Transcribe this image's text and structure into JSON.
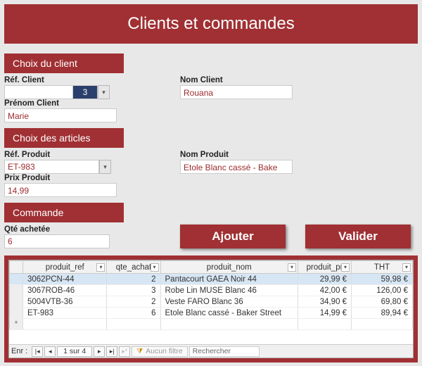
{
  "title": "Clients et commandes",
  "sections": {
    "client": "Choix du client",
    "articles": "Choix des articles",
    "commande": "Commande"
  },
  "labels": {
    "ref_client": "Réf. Client",
    "nom_client": "Nom Client",
    "prenom_client": "Prénom Client",
    "ref_produit": "Réf. Produit",
    "nom_produit": "Nom Produit",
    "prix_produit": "Prix Produit",
    "qte": "Qté achetée"
  },
  "values": {
    "ref_client": "3",
    "nom_client": "Rouana",
    "prenom_client": "Marie",
    "ref_produit": "ET-983",
    "nom_produit": "Etole Blanc cassé - Bake",
    "prix_produit": "14,99",
    "qte": "6"
  },
  "buttons": {
    "ajouter": "Ajouter",
    "valider": "Valider"
  },
  "grid": {
    "headers": {
      "produit_ref": "produit_ref",
      "qte_achat": "qte_achat",
      "produit_nom": "produit_nom",
      "produit_pr": "produit_pr",
      "tht": "THT"
    },
    "rows": [
      {
        "ref": "3062PCN-44",
        "qte": "2",
        "nom": "Pantacourt GAEA Noir 44",
        "prix": "29,99 €",
        "tht": "59,98 €"
      },
      {
        "ref": "3067ROB-46",
        "qte": "3",
        "nom": "Robe Lin MUSE Blanc 46",
        "prix": "42,00 €",
        "tht": "126,00 €"
      },
      {
        "ref": "5004VTB-36",
        "qte": "2",
        "nom": "Veste FARO Blanc 36",
        "prix": "34,90 €",
        "tht": "69,80 €"
      },
      {
        "ref": "ET-983",
        "qte": "6",
        "nom": "Etole Blanc cassé - Baker Street",
        "prix": "14,99 €",
        "tht": "89,94 €"
      }
    ],
    "nav": {
      "label": "Enr :",
      "position": "1 sur 4",
      "filter": "Aucun filtre",
      "search": "Rechercher"
    }
  }
}
